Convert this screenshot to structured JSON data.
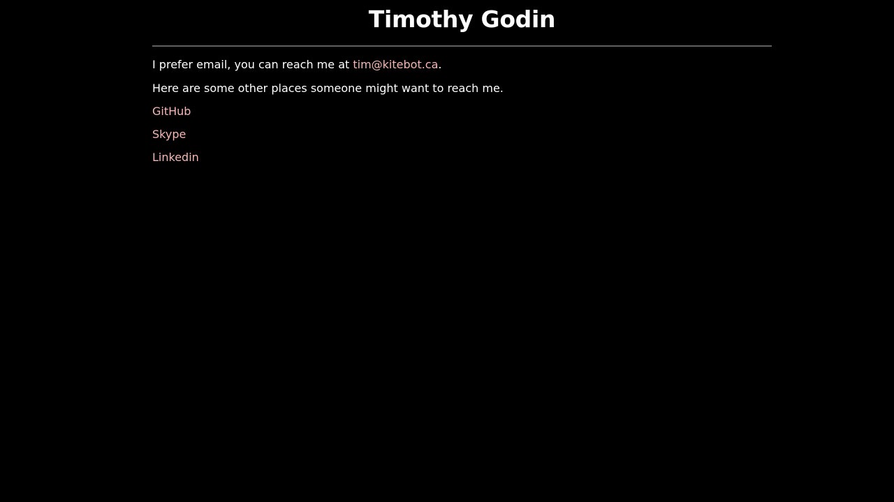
{
  "page": {
    "title": "Timothy Godin"
  },
  "intro": {
    "prefix": "I prefer email, you can reach me at ",
    "email": "tim@kitebot.ca",
    "suffix": "."
  },
  "other_places_text": "Here are some other places someone might want to reach me.",
  "links": [
    {
      "label": "GitHub"
    },
    {
      "label": "Skype"
    },
    {
      "label": "Linkedin"
    }
  ],
  "colors": {
    "background": "#000000",
    "text": "#ffffff",
    "link": "#f4b8b4",
    "rule": "#5f5f5f"
  }
}
